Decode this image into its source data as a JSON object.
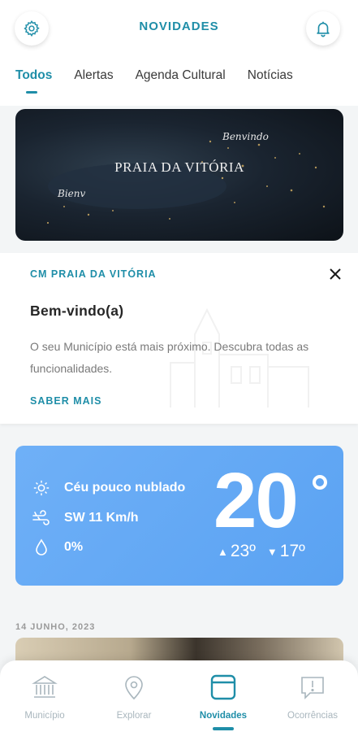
{
  "header": {
    "title": "NOVIDADES",
    "settings_icon": "gear-icon",
    "notifications_icon": "bell-icon"
  },
  "tabs": [
    {
      "label": "Todos",
      "active": true
    },
    {
      "label": "Alertas",
      "active": false
    },
    {
      "label": "Agenda Cultural",
      "active": false
    },
    {
      "label": "Notícias",
      "active": false
    }
  ],
  "banner": {
    "title": "PRAIA DA VITÓRIA",
    "script_top": "Benvindo",
    "script_bottom": "Bienv"
  },
  "welcome_card": {
    "organization": "CM PRAIA DA VITÓRIA",
    "title": "Bem-vindo(a)",
    "body": "O seu Município está mais próximo. Descubra todas as funcionalidades.",
    "link": "SABER MAIS"
  },
  "weather": {
    "condition": "Céu pouco nublado",
    "wind": "SW 11 Km/h",
    "precipitation": "0%",
    "temperature": "20",
    "max": "23º",
    "min": "17º",
    "accent_color": "#5aa2f2"
  },
  "feed": {
    "date": "14 JUNHO, 2023"
  },
  "bottom_nav": [
    {
      "label": "Município",
      "icon": "institution-icon",
      "active": false
    },
    {
      "label": "Explorar",
      "icon": "map-pin-icon",
      "active": false
    },
    {
      "label": "Novidades",
      "icon": "news-icon",
      "active": true
    },
    {
      "label": "Ocorrências",
      "icon": "alert-bubble-icon",
      "active": false
    }
  ],
  "colors": {
    "primary": "#1f8ea8",
    "inactive": "#a9b6bd"
  }
}
